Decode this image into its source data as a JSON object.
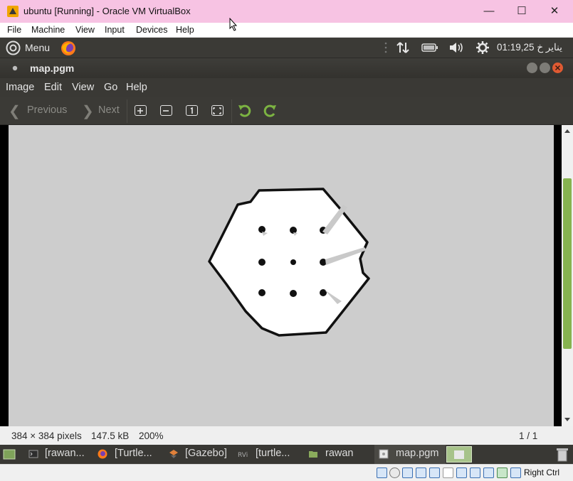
{
  "host_window": {
    "title": "ubuntu [Running] - Oracle VM VirtualBox",
    "minimize_glyph": "—",
    "maximize_glyph": "☐",
    "close_glyph": "✕",
    "menu": [
      "File",
      "Machine",
      "View",
      "Input",
      "Devices",
      "Help"
    ]
  },
  "guest_panel": {
    "menu_label": "Menu",
    "clock": "01:19,25 يناير خ"
  },
  "viewer": {
    "title": "map.pgm",
    "menu": [
      "Image",
      "Edit",
      "View",
      "Go",
      "Help"
    ],
    "toolbar": {
      "previous_label": "Previous",
      "next_label": "Next",
      "prev_glyph": "❮",
      "next_glyph": "❯"
    },
    "status": {
      "dimensions": "384 × 384 pixels",
      "size": "147.5 kB",
      "zoom": "200%",
      "page": "1 / 1"
    }
  },
  "taskbar": {
    "items": [
      "[rawan...",
      "[Turtle...",
      "[Gazebo]",
      "[turtle...",
      "rawan",
      "map.pgm"
    ]
  },
  "vbox_status": {
    "host_key": "Right Ctrl"
  },
  "colors": {
    "host_title_bg": "#f7c3e3",
    "panel_bg": "#3b3a36",
    "canvas_bg": "#cdcdcd",
    "scroll_thumb": "#86b350",
    "close_button": "#e05a32"
  }
}
